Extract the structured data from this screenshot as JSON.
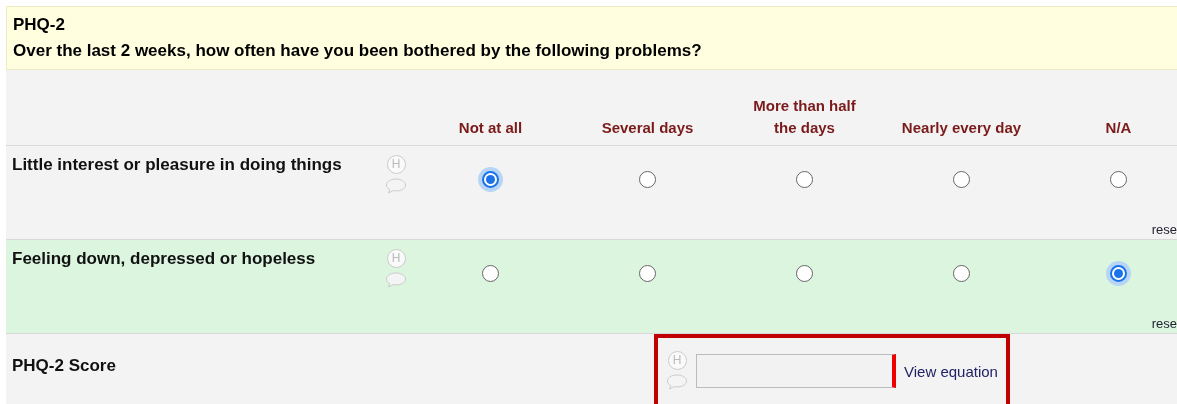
{
  "header": {
    "title": "PHQ-2",
    "question": "Over the last 2 weeks, how often have you been bothered by the following problems?"
  },
  "choices": [
    "Not at all",
    "Several days",
    "More than half the days",
    "Nearly every day",
    "N/A"
  ],
  "rows": [
    {
      "label": "Little interest or pleasure in doing things",
      "help_mark": "H",
      "highlighted": false,
      "options": [
        {
          "selected": true
        },
        {
          "selected": false
        },
        {
          "selected": false
        },
        {
          "selected": false
        },
        {
          "selected": false
        }
      ],
      "reset": "rese"
    },
    {
      "label": "Feeling down, depressed or hopeless",
      "help_mark": "H",
      "highlighted": true,
      "options": [
        {
          "selected": false
        },
        {
          "selected": false
        },
        {
          "selected": false
        },
        {
          "selected": false
        },
        {
          "selected": true
        }
      ],
      "reset": "rese"
    }
  ],
  "score": {
    "label": "PHQ-2 Score",
    "help_mark": "H",
    "link": "View equation"
  }
}
